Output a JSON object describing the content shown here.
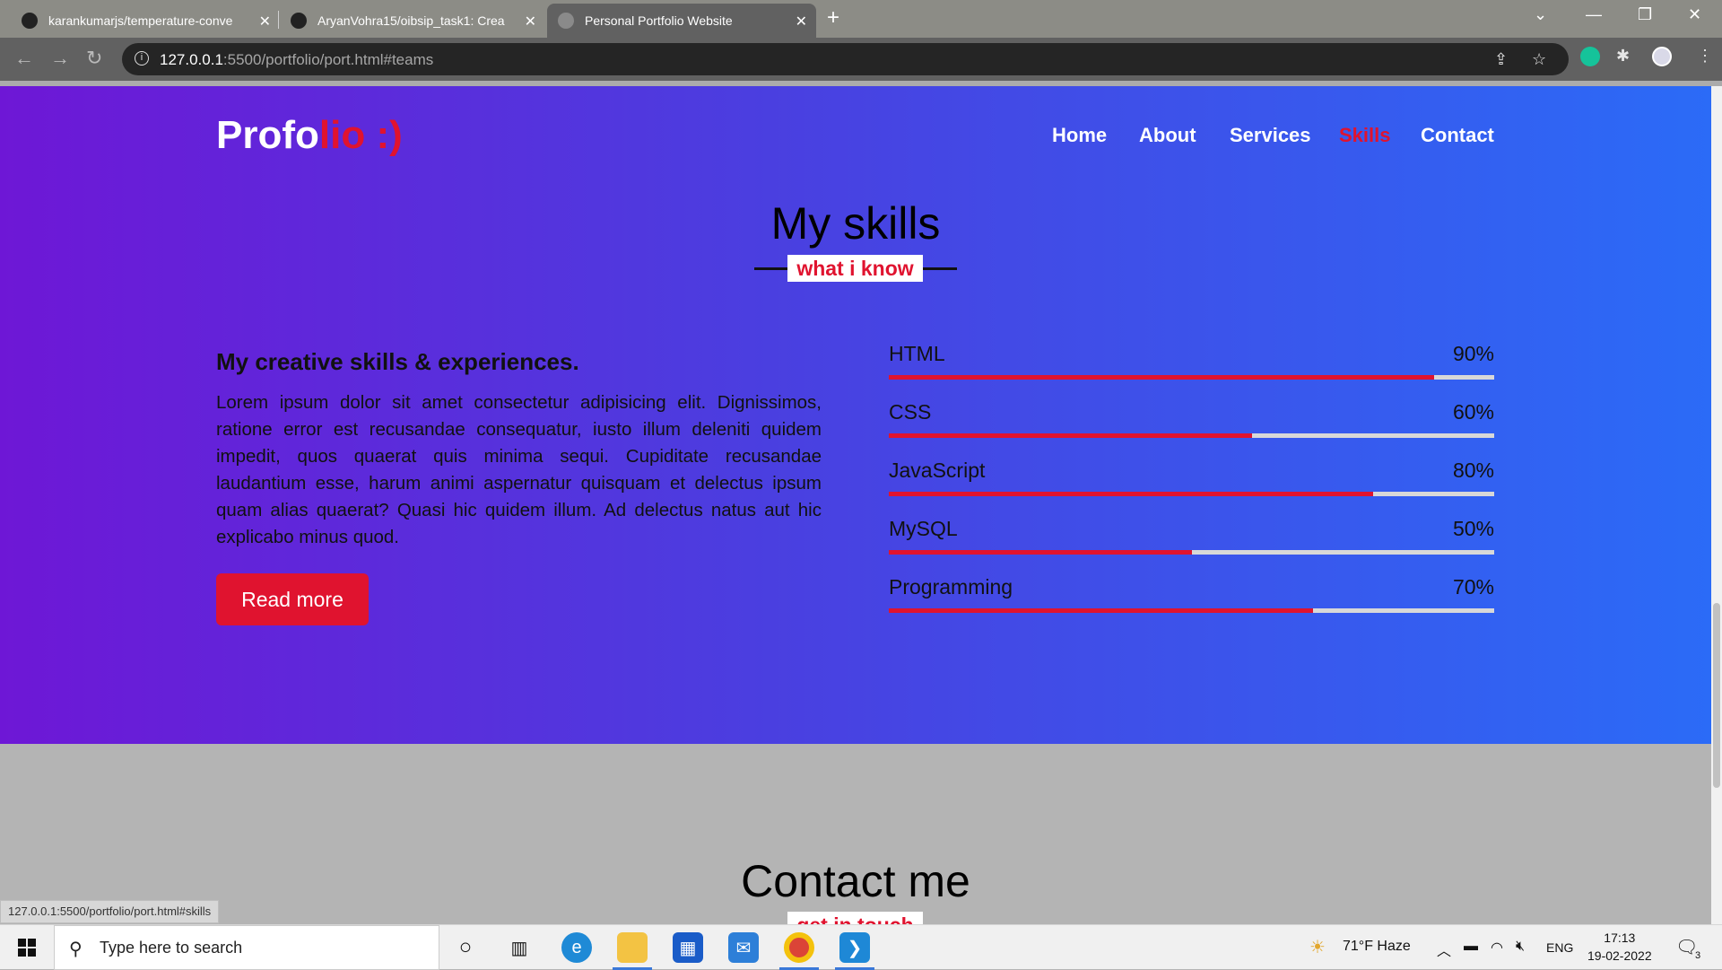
{
  "browser": {
    "tabs": [
      {
        "title": "karankumarjs/temperature-conve"
      },
      {
        "title": "AryanVohra15/oibsip_task1: Crea"
      },
      {
        "title": "Personal Portfolio Website"
      }
    ],
    "url_host": "127.0.0.1",
    "url_path": ":5500/portfolio/port.html#teams",
    "status_url": "127.0.0.1:5500/portfolio/port.html#skills"
  },
  "site": {
    "logo_white": "Profo",
    "logo_red": "lio :)",
    "nav": [
      "Home",
      "About",
      "Services",
      "Skills",
      "Contact"
    ],
    "active_nav": "Skills"
  },
  "skills_section": {
    "title": "My skills",
    "subtitle": "what i know",
    "heading": "My creative skills & experiences.",
    "paragraph": "Lorem ipsum dolor sit amet consectetur adipisicing elit. Dignissimos, ratione error est recusandae consequatur, iusto illum deleniti quidem impedit, quos quaerat quis minima sequi. Cupiditate recusandae laudantium esse, harum animi aspernatur quisquam et delectus ipsum quam alias quaerat? Quasi hic quidem illum. Ad delectus natus aut hic explicabo minus quod.",
    "button": "Read more",
    "skills": [
      {
        "name": "HTML",
        "percent_label": "90%",
        "level": 0.9
      },
      {
        "name": "CSS",
        "percent_label": "60%",
        "level": 0.6
      },
      {
        "name": "JavaScript",
        "percent_label": "80%",
        "level": 0.8
      },
      {
        "name": "MySQL",
        "percent_label": "50%",
        "level": 0.5
      },
      {
        "name": "Programming",
        "percent_label": "70%",
        "level": 0.7
      }
    ]
  },
  "contact_section": {
    "title": "Contact me",
    "subtitle": "get in touch"
  },
  "taskbar": {
    "search_placeholder": "Type here to search",
    "weather": "71°F  Haze",
    "lang": "ENG",
    "time": "17:13",
    "date": "19-02-2022",
    "notifications": "3"
  },
  "colors": {
    "accent": "#e0132f",
    "gradient_start": "#6e17d6",
    "gradient_end": "#2b6bf7"
  }
}
